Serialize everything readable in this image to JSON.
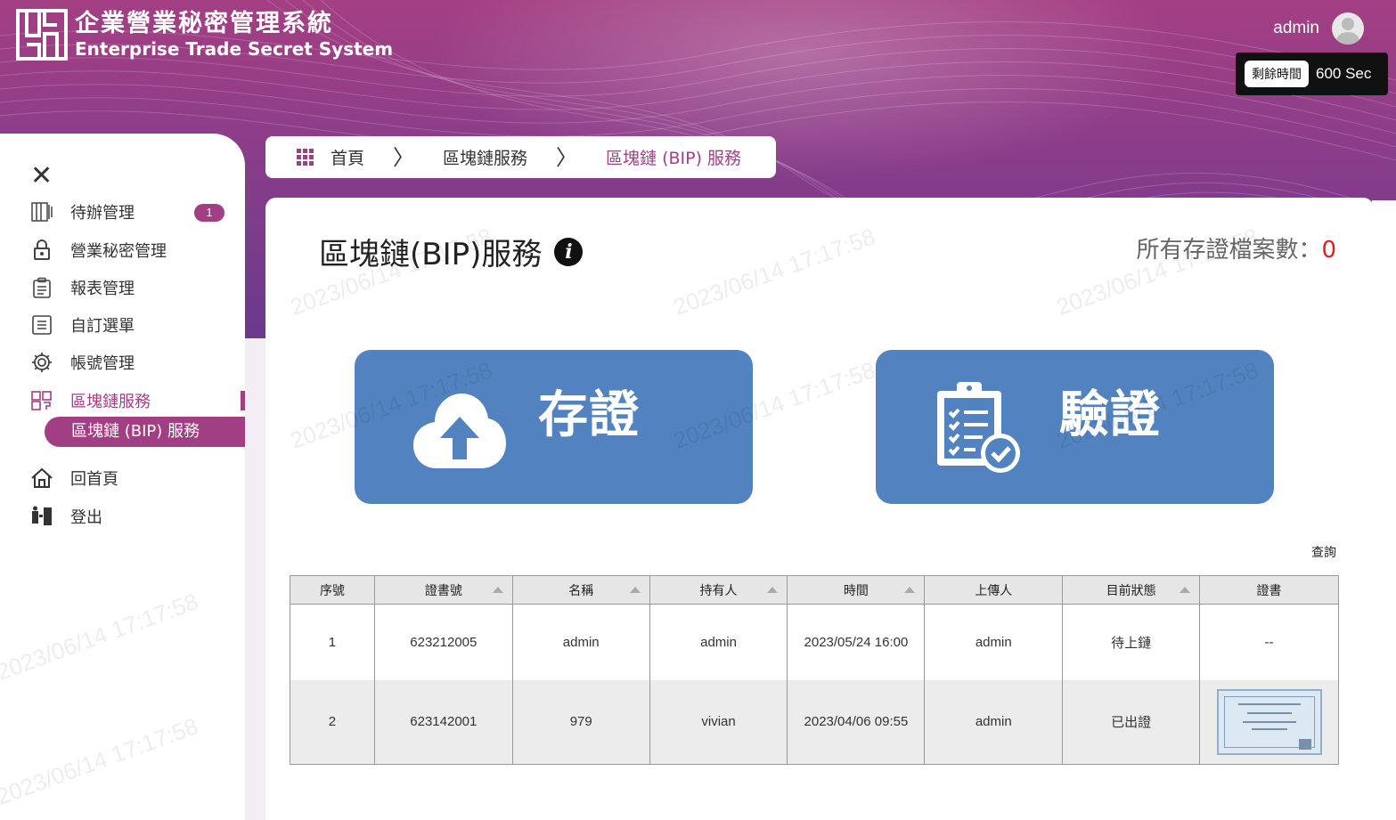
{
  "app": {
    "title_cn": "企業營業秘密管理系統",
    "title_en": "Enterprise Trade Secret System"
  },
  "user": {
    "name": "admin",
    "timer_label": "剩餘時間",
    "timer_value": "600 Sec"
  },
  "sidebar": {
    "close_icon": "close-icon",
    "items": [
      {
        "label": "待辦管理",
        "icon": "todo-icon",
        "badge": "1"
      },
      {
        "label": "營業秘密管理",
        "icon": "lock-icon"
      },
      {
        "label": "報表管理",
        "icon": "clipboard-icon"
      },
      {
        "label": "自訂選單",
        "icon": "list-icon"
      },
      {
        "label": "帳號管理",
        "icon": "gear-icon"
      },
      {
        "label": "區塊鏈服務",
        "icon": "blockchain-icon"
      },
      {
        "label": "回首頁",
        "icon": "home-icon"
      },
      {
        "label": "登出",
        "icon": "logout-icon"
      }
    ],
    "sub_item": "區塊鏈 (BIP) 服務"
  },
  "breadcrumb": {
    "home": "首頁",
    "level1": "區塊鏈服務",
    "level2": "區塊鏈 (BIP) 服務"
  },
  "main": {
    "title": "區塊鏈(BIP)服務",
    "count_label": "所有存證檔案數：",
    "count_value": "0",
    "store_button": "存證",
    "verify_button": "驗證",
    "query_link": "查詢"
  },
  "table": {
    "headers": [
      "序號",
      "證書號",
      "名稱",
      "持有人",
      "時間",
      "上傳人",
      "目前狀態",
      "證書"
    ],
    "rows": [
      [
        "1",
        "623212005",
        "admin",
        "admin",
        "2023/05/24 16:00",
        "admin",
        "待上鏈",
        "--"
      ],
      [
        "2",
        "623142001",
        "979",
        "vivian",
        "2023/04/06 09:55",
        "admin",
        "已出證",
        ""
      ]
    ]
  },
  "colors": {
    "accent": "#a23f84",
    "button_blue": "#5283c0",
    "count_red": "#e02020"
  }
}
